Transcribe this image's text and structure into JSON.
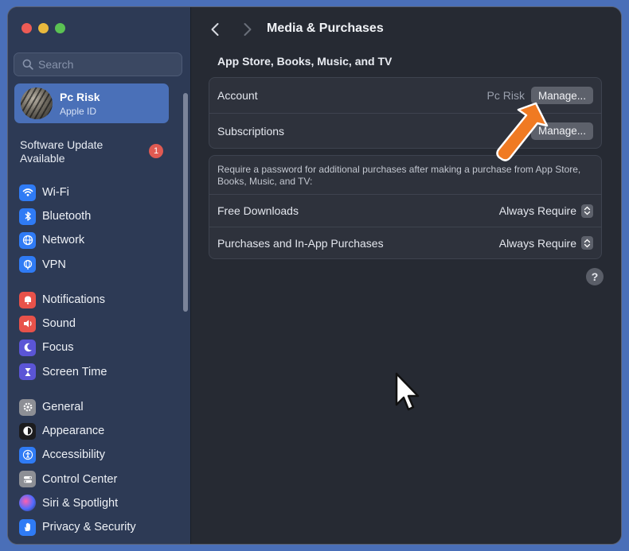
{
  "window": {
    "title": "Media & Purchases"
  },
  "sidebar": {
    "search_placeholder": "Search",
    "account": {
      "name": "Pc Risk",
      "subtitle": "Apple ID"
    },
    "software_update": {
      "line1": "Software Update",
      "line2": "Available",
      "badge": "1"
    },
    "group1": [
      {
        "label": "Wi-Fi",
        "icon": "wifi-icon",
        "color": "#2f7bf5"
      },
      {
        "label": "Bluetooth",
        "icon": "bluetooth-icon",
        "color": "#2f7bf5"
      },
      {
        "label": "Network",
        "icon": "globe-icon",
        "color": "#2f7bf5"
      },
      {
        "label": "VPN",
        "icon": "vpn-globe-icon",
        "color": "#2f7bf5"
      }
    ],
    "group2": [
      {
        "label": "Notifications",
        "icon": "bell-icon",
        "color": "#e8524a"
      },
      {
        "label": "Sound",
        "icon": "speaker-icon",
        "color": "#e8524a"
      },
      {
        "label": "Focus",
        "icon": "moon-icon",
        "color": "#5b55d6"
      },
      {
        "label": "Screen Time",
        "icon": "hourglass-icon",
        "color": "#5b55d6"
      }
    ],
    "group3": [
      {
        "label": "General",
        "icon": "gear-icon",
        "color": "#8d8f95"
      },
      {
        "label": "Appearance",
        "icon": "appearance-icon",
        "color": "#1c1c1e"
      },
      {
        "label": "Accessibility",
        "icon": "accessibility-icon",
        "color": "#2f7bf5"
      },
      {
        "label": "Control Center",
        "icon": "toggles-icon",
        "color": "#8d8f95"
      },
      {
        "label": "Siri & Spotlight",
        "icon": "siri-icon",
        "color": "#3a3a5e"
      },
      {
        "label": "Privacy & Security",
        "icon": "hand-icon",
        "color": "#2f7bf5"
      }
    ]
  },
  "main": {
    "section_title": "App Store, Books, Music, and TV",
    "account_row": {
      "label": "Account",
      "value": "Pc Risk",
      "button": "Manage..."
    },
    "subscriptions_row": {
      "label": "Subscriptions",
      "button": "Manage..."
    },
    "password_desc": "Require a password for additional purchases after making a purchase from App Store, Books, Music, and TV:",
    "free_downloads": {
      "label": "Free Downloads",
      "value": "Always Require"
    },
    "purchases": {
      "label": "Purchases and In-App Purchases",
      "value": "Always Require"
    },
    "help": "?"
  },
  "colors": {
    "accent": "#4a70b8",
    "annotation_arrow": "#f07a22"
  }
}
